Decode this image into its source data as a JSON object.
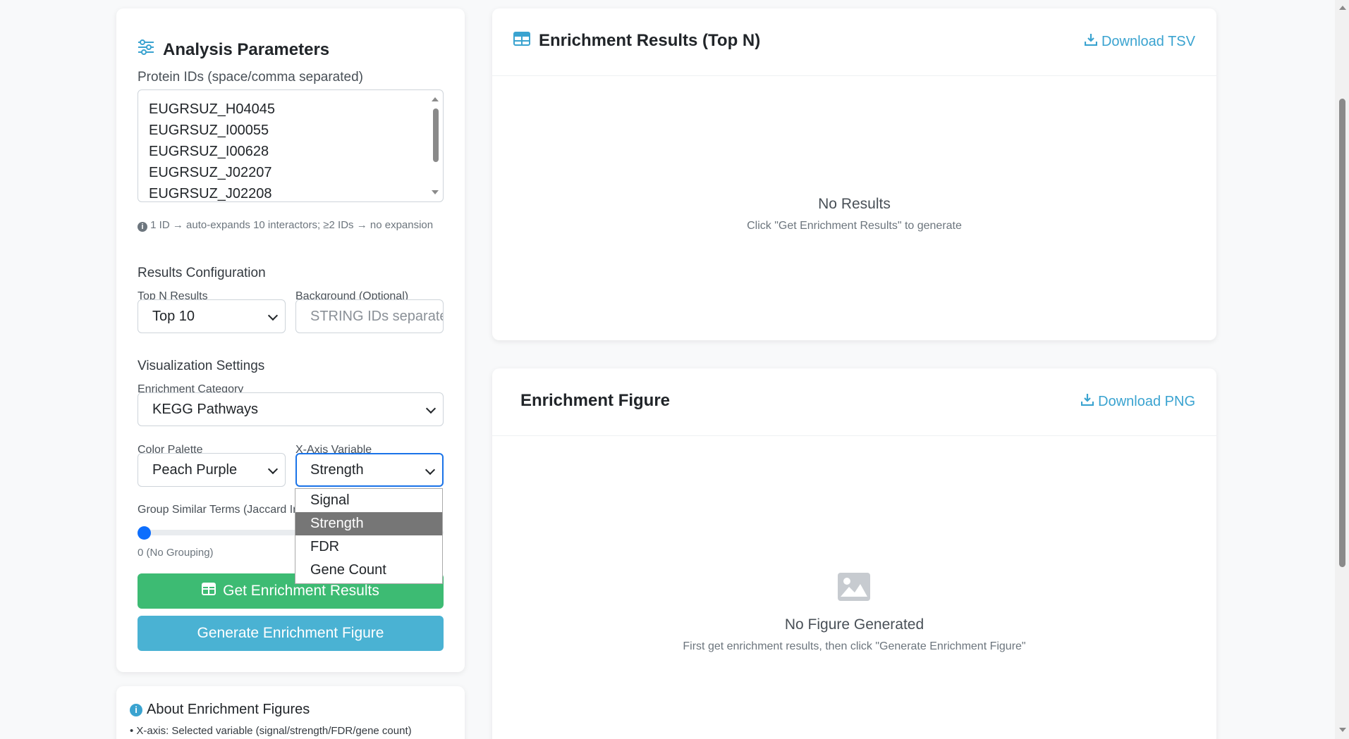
{
  "params": {
    "title": "Analysis Parameters",
    "protein_ids_label": "Protein IDs (space/comma separated)",
    "protein_ids": [
      "EUGRSUZ_H04045",
      "EUGRSUZ_I00055",
      "EUGRSUZ_I00628",
      "EUGRSUZ_J02207",
      "EUGRSUZ_J02208"
    ],
    "hint": "1 ID → auto-expands 10 interactors; ≥2 IDs → no expansion",
    "results_config_title": "Results Configuration",
    "top_n_label": "Top N Results",
    "top_n_value": "Top 10",
    "background_label": "Background (Optional)",
    "background_placeholder": "STRING IDs separated",
    "vis_settings_title": "Visualization Settings",
    "category_label": "Enrichment Category",
    "category_value": "KEGG Pathways",
    "palette_label": "Color Palette",
    "palette_value": "Peach Purple",
    "xaxis_label": "X-Axis Variable",
    "xaxis_value": "Strength",
    "group_label": "Group Similar Terms (Jaccard In",
    "group_value_text": "0 (No Grouping)",
    "group_value": 0,
    "get_results_button": "Get Enrichment Results",
    "generate_figure_button": "Generate Enrichment Figure"
  },
  "xaxis_dropdown": {
    "options": [
      "Signal",
      "Strength",
      "FDR",
      "Gene Count"
    ],
    "selected": "Strength"
  },
  "about": {
    "title": "About Enrichment Figures",
    "line1": "• X-axis: Selected variable (signal/strength/FDR/gene count)"
  },
  "results": {
    "title": "Enrichment Results (Top N)",
    "download_label": "Download TSV",
    "empty_title": "No Results",
    "empty_sub": "Click \"Get Enrichment Results\" to generate"
  },
  "figure": {
    "title": "Enrichment Figure",
    "download_label": "Download PNG",
    "empty_title": "No Figure Generated",
    "empty_sub": "First get enrichment results, then click \"Generate Enrichment Figure\""
  },
  "colors": {
    "accent_blue": "#4ab2d3",
    "accent_green": "#3dbb73",
    "focus_blue": "#1a73e8"
  }
}
